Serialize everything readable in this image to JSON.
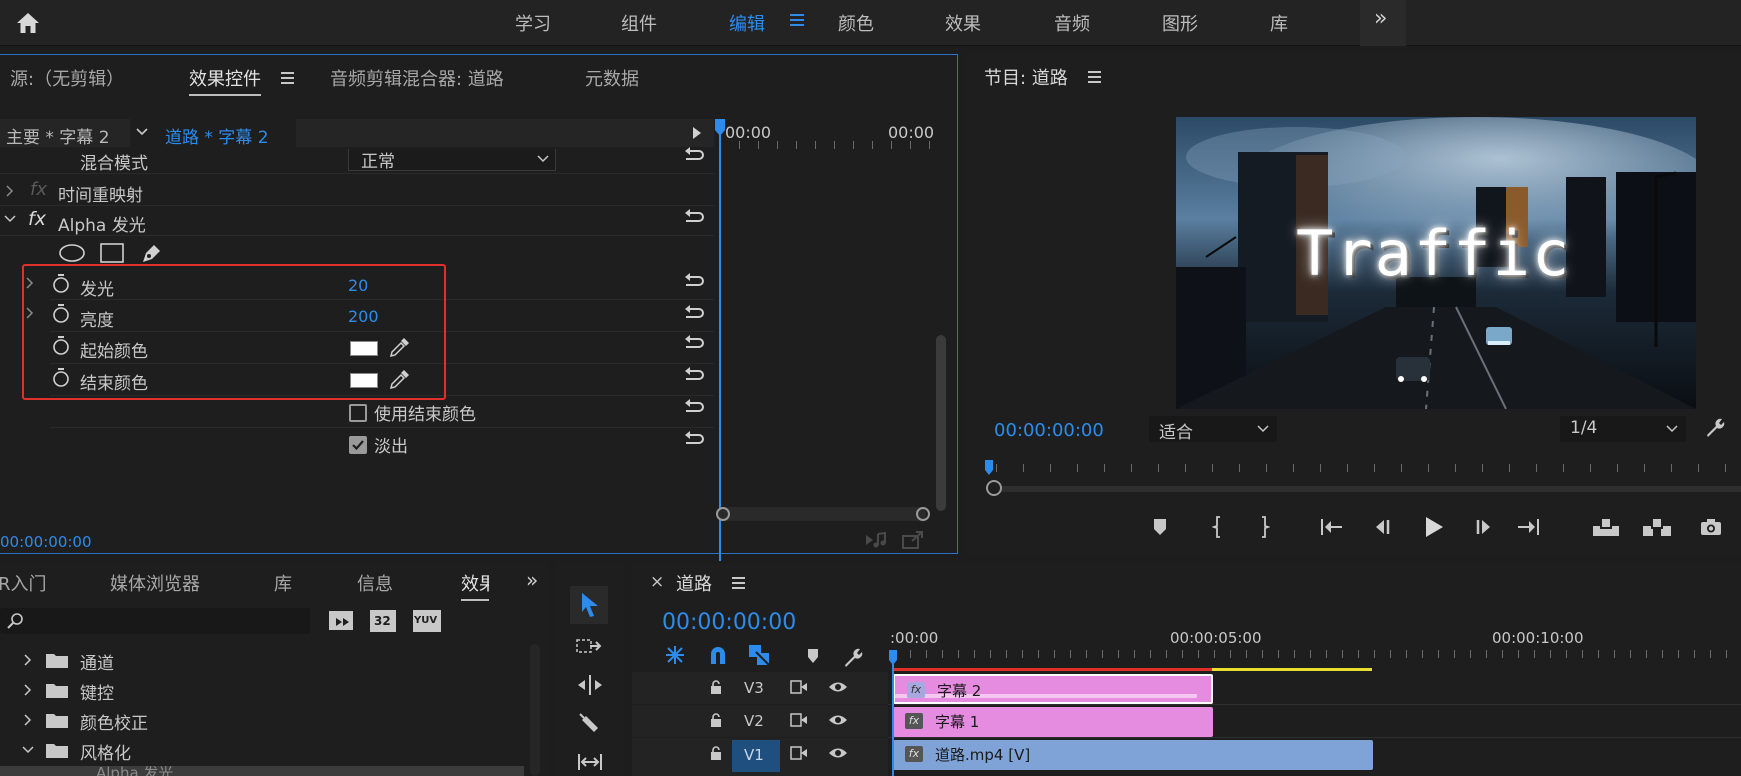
{
  "workspaces": {
    "items": [
      "学习",
      "组件",
      "编辑",
      "颜色",
      "效果",
      "音频",
      "图形",
      "库"
    ],
    "active": "编辑",
    "more": "»"
  },
  "effects_panel": {
    "tabs": {
      "source": "源:（无剪辑）",
      "effect_controls": "效果控件",
      "audio_mixer": "音频剪辑混合器: 道路",
      "metadata": "元数据"
    },
    "master_clip": "主要 * 字幕 2",
    "seq_clip": "道路 * 字幕 2",
    "timeline_start": "00:00",
    "timeline_end": "00:00",
    "blend_mode_label": "混合模式",
    "blend_mode_value": "正常",
    "time_remap_label": "时间重映射",
    "alpha_glow_label": "Alpha 发光",
    "fx_symbol": "fx",
    "params": [
      {
        "label": "发光",
        "value": "20"
      },
      {
        "label": "亮度",
        "value": "200"
      },
      {
        "label": "起始颜色",
        "color": "#ffffff"
      },
      {
        "label": "结束颜色",
        "color": "#ffffff"
      }
    ],
    "use_end_color_label": "使用结束颜色",
    "fade_out_label": "淡出",
    "timecode": "00:00:00:00"
  },
  "program_monitor": {
    "title": "节目: 道路",
    "overlay_title": "Traffic",
    "timecode": "00:00:00:00",
    "fit": "适合",
    "resolution": "1/4"
  },
  "project_panel": {
    "tabs": {
      "learn": "R入门",
      "media_browser": "媒体浏览器",
      "library": "库",
      "info": "信息",
      "effects": "效果"
    },
    "more": "»",
    "folders": [
      "通道",
      "键控",
      "颜色校正",
      "风格化"
    ],
    "subitem": "Alpha 发光",
    "badge_32": "32",
    "badge_yuv": "YUV"
  },
  "timeline": {
    "title": "道路",
    "close": "×",
    "timecode": "00:00:00:00",
    "ruler": [
      ":00:00",
      "00:00:05:00",
      "00:00:10:00"
    ],
    "tracks": [
      "V3",
      "V2",
      "V1"
    ],
    "clips": [
      {
        "label": "字幕 2",
        "color": "#e58be0"
      },
      {
        "label": "字幕 1",
        "color": "#e58be0"
      },
      {
        "label": "道路.mp4 [V]",
        "color": "#7fa3d6"
      }
    ]
  },
  "colors": {
    "accent": "#2d8ceb",
    "highlight": "#e0302a",
    "title_clip": "#e58be0",
    "video_clip": "#7fa3d6",
    "workarea": "#e8e030"
  }
}
